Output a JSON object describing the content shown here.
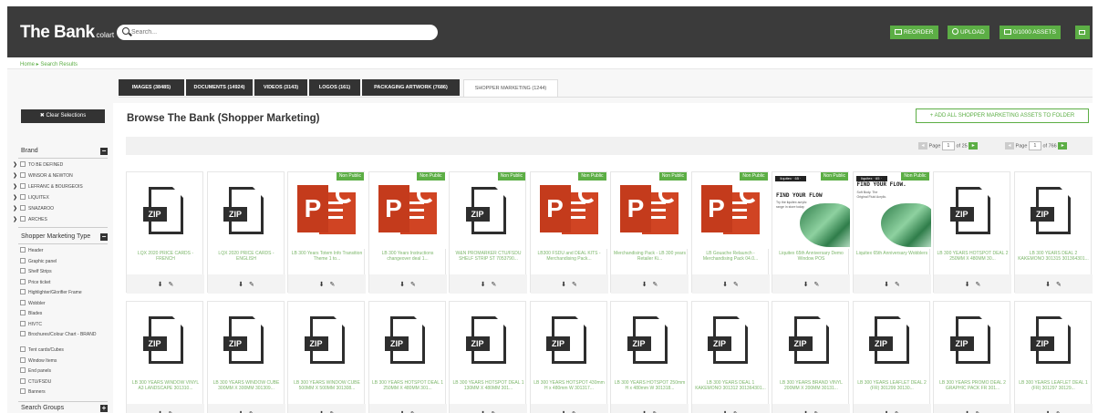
{
  "header": {
    "logo": "The Bank",
    "logo_sub": "colart",
    "search_placeholder": "Search...",
    "buttons": {
      "reorder": "REORDER",
      "upload": "UPLOAD",
      "assets": "0/1000 ASSETS"
    }
  },
  "breadcrumb": "Home ▸ Search Results",
  "tabs": [
    {
      "label": "IMAGES (38485)"
    },
    {
      "label": "DOCUMENTS (14924)"
    },
    {
      "label": "VIDEOS (3143)"
    },
    {
      "label": "LOGOS (161)"
    },
    {
      "label": "PACKAGING ARTWORK (7686)"
    },
    {
      "label": "SHOPPER MARKETING (1244)"
    }
  ],
  "sidebar": {
    "clear_label": "Clear Selections",
    "brand_heading": "Brand",
    "brand_items": [
      {
        "label": "TO BE DEFINED"
      },
      {
        "label": "WINSOR & NEWTON"
      },
      {
        "label": "LEFRANC & BOURGEOIS"
      },
      {
        "label": "LIQUITEX"
      },
      {
        "label": "SNAZAROO"
      },
      {
        "label": "ARCHES"
      }
    ],
    "smt_heading": "Shopper Marketing Type",
    "smt_items": [
      {
        "label": "Header"
      },
      {
        "label": "Graphic panel"
      },
      {
        "label": "Shelf Strips"
      },
      {
        "label": "Price ticket"
      },
      {
        "label": "Highlighter/Glorifier Frame"
      },
      {
        "label": "Wobbler"
      },
      {
        "label": "Blades"
      },
      {
        "label": "HIVTC"
      },
      {
        "label": "Brochures/Colour Chart - BRAND"
      },
      {
        "label": "Tent cards/Cubes"
      },
      {
        "label": "Window Items"
      },
      {
        "label": "End panels"
      },
      {
        "label": "CTU/FSDU"
      },
      {
        "label": "Banners"
      }
    ],
    "groups_heading": "Search Groups"
  },
  "main": {
    "title": "Browse The Bank (Shopper Marketing)",
    "add_all_label": "ADD ALL SHOPPER MARKETING ASSETS TO FOLDER",
    "pager1": {
      "page_label": "Page",
      "page": "1",
      "of": "of 25"
    },
    "pager2": {
      "page_label": "Page",
      "page": "1",
      "of": "of 766"
    },
    "non_public_label": "Non Public",
    "zip_label": "ZIP",
    "ppt_letter": "P",
    "pos_texts": {
      "badge": "liquitex · 65 ·",
      "headline": "FIND YOUR FLOW",
      "headline2": "FIND YOUR FLOW.",
      "body": "Try the liquitex acrylic range in store today",
      "body2": "Soft Body. The Original Fluid Acrylic."
    },
    "tiles_row1": [
      {
        "type": "zip",
        "non_public": false,
        "title": "LQX 2020 PRICE CARDS - FRENCH"
      },
      {
        "type": "zip",
        "non_public": false,
        "title": "LQX 2020 PRICE CARDS - ENGLISH"
      },
      {
        "type": "ppt",
        "non_public": true,
        "title": "LB 300 Years Totem Info Transition Theme 1 to..."
      },
      {
        "type": "ppt",
        "non_public": true,
        "title": "LB 300 Years Instructions changeover deal 1..."
      },
      {
        "type": "zip",
        "non_public": true,
        "title": "W&N PROMARKER CTU/FSDU SHELF STRIP ST 7053790..."
      },
      {
        "type": "ppt",
        "non_public": true,
        "title": "LB300 FSDU and DEAL KITS - Merchandising Pack..."
      },
      {
        "type": "ppt",
        "non_public": true,
        "title": "Merchandising Pack - LB 300 years Retailer Ki..."
      },
      {
        "type": "ppt",
        "non_public": true,
        "title": "LB Gouache Relaunch - Merchandising Pack 04.0..."
      },
      {
        "type": "pos",
        "non_public": true,
        "title": "Liquitex 65th Anniversary Demo Window POS"
      },
      {
        "type": "pos2",
        "non_public": true,
        "title": "Liquitex 65th Anniversary Wobblers"
      },
      {
        "type": "zip",
        "non_public": false,
        "title": "LB 300 YEARS HOTSPOT DEAL 2 250MM X 480MM 30..."
      },
      {
        "type": "zip",
        "non_public": false,
        "title": "LB 300 YEARS DEAL 2 KAKEMONO 301315 301364301..."
      }
    ],
    "tiles_row2": [
      {
        "title": "LB 300 YEARS WINDOW VINYL A3 LANDSCAPE 301310..."
      },
      {
        "title": "LB 300 YEARS WINDOW CUBE 300MM X 300MM 301309..."
      },
      {
        "title": "LB 300 YEARS WINDOW CUBE 500MM X 500MM 301308..."
      },
      {
        "title": "LB 300 YEARS HOTSPOT DEAL 1 250MM X 480MM 301..."
      },
      {
        "title": "LB 300 YEARS HOTSPOT DEAL 1 130MM X 480MM 301..."
      },
      {
        "title": "LB 300 YEARS HOTSPOT 430mm H x 480mm W 301317..."
      },
      {
        "title": "LB 300 YEARS HOTSPOT 250mm H x 480mm W 301318..."
      },
      {
        "title": "LB 300 YEARS DEAL 1 KAKEMONO 301312 301364301..."
      },
      {
        "title": "LB 300 YEARS BRAND VINYL 200MM X 200MM 30131..."
      },
      {
        "title": "LB 300 YEARS LEAFLET DEAL 2 (FR) 301299 30130..."
      },
      {
        "title": "LB 300 YEARS PROMO DEAL 2 GRAPHIC PACK FR 301..."
      },
      {
        "title": "LB 300 YEARS LEAFLET DEAL 1 (FR) 301297 30129..."
      }
    ]
  },
  "colors": {
    "accent": "#5cae45",
    "header_bg": "#3b3b3b",
    "ppt_red": "#c43b1c"
  }
}
